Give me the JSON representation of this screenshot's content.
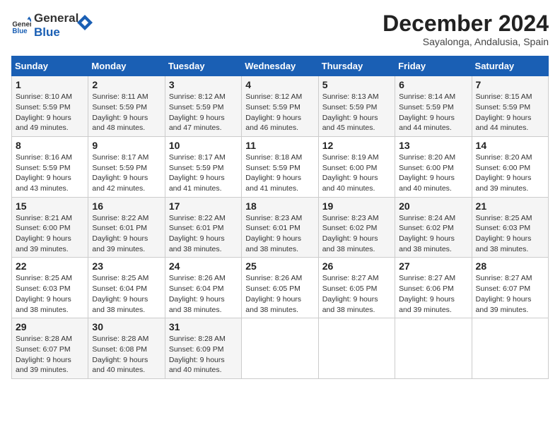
{
  "logo": {
    "line1": "General",
    "line2": "Blue"
  },
  "title": "December 2024",
  "subtitle": "Sayalonga, Andalusia, Spain",
  "weekdays": [
    "Sunday",
    "Monday",
    "Tuesday",
    "Wednesday",
    "Thursday",
    "Friday",
    "Saturday"
  ],
  "weeks": [
    [
      {
        "day": "1",
        "sunrise": "8:10 AM",
        "sunset": "5:59 PM",
        "daylight": "9 hours and 49 minutes."
      },
      {
        "day": "2",
        "sunrise": "8:11 AM",
        "sunset": "5:59 PM",
        "daylight": "9 hours and 48 minutes."
      },
      {
        "day": "3",
        "sunrise": "8:12 AM",
        "sunset": "5:59 PM",
        "daylight": "9 hours and 47 minutes."
      },
      {
        "day": "4",
        "sunrise": "8:12 AM",
        "sunset": "5:59 PM",
        "daylight": "9 hours and 46 minutes."
      },
      {
        "day": "5",
        "sunrise": "8:13 AM",
        "sunset": "5:59 PM",
        "daylight": "9 hours and 45 minutes."
      },
      {
        "day": "6",
        "sunrise": "8:14 AM",
        "sunset": "5:59 PM",
        "daylight": "9 hours and 44 minutes."
      },
      {
        "day": "7",
        "sunrise": "8:15 AM",
        "sunset": "5:59 PM",
        "daylight": "9 hours and 44 minutes."
      }
    ],
    [
      {
        "day": "8",
        "sunrise": "8:16 AM",
        "sunset": "5:59 PM",
        "daylight": "9 hours and 43 minutes."
      },
      {
        "day": "9",
        "sunrise": "8:17 AM",
        "sunset": "5:59 PM",
        "daylight": "9 hours and 42 minutes."
      },
      {
        "day": "10",
        "sunrise": "8:17 AM",
        "sunset": "5:59 PM",
        "daylight": "9 hours and 41 minutes."
      },
      {
        "day": "11",
        "sunrise": "8:18 AM",
        "sunset": "5:59 PM",
        "daylight": "9 hours and 41 minutes."
      },
      {
        "day": "12",
        "sunrise": "8:19 AM",
        "sunset": "6:00 PM",
        "daylight": "9 hours and 40 minutes."
      },
      {
        "day": "13",
        "sunrise": "8:20 AM",
        "sunset": "6:00 PM",
        "daylight": "9 hours and 40 minutes."
      },
      {
        "day": "14",
        "sunrise": "8:20 AM",
        "sunset": "6:00 PM",
        "daylight": "9 hours and 39 minutes."
      }
    ],
    [
      {
        "day": "15",
        "sunrise": "8:21 AM",
        "sunset": "6:00 PM",
        "daylight": "9 hours and 39 minutes."
      },
      {
        "day": "16",
        "sunrise": "8:22 AM",
        "sunset": "6:01 PM",
        "daylight": "9 hours and 39 minutes."
      },
      {
        "day": "17",
        "sunrise": "8:22 AM",
        "sunset": "6:01 PM",
        "daylight": "9 hours and 38 minutes."
      },
      {
        "day": "18",
        "sunrise": "8:23 AM",
        "sunset": "6:01 PM",
        "daylight": "9 hours and 38 minutes."
      },
      {
        "day": "19",
        "sunrise": "8:23 AM",
        "sunset": "6:02 PM",
        "daylight": "9 hours and 38 minutes."
      },
      {
        "day": "20",
        "sunrise": "8:24 AM",
        "sunset": "6:02 PM",
        "daylight": "9 hours and 38 minutes."
      },
      {
        "day": "21",
        "sunrise": "8:25 AM",
        "sunset": "6:03 PM",
        "daylight": "9 hours and 38 minutes."
      }
    ],
    [
      {
        "day": "22",
        "sunrise": "8:25 AM",
        "sunset": "6:03 PM",
        "daylight": "9 hours and 38 minutes."
      },
      {
        "day": "23",
        "sunrise": "8:25 AM",
        "sunset": "6:04 PM",
        "daylight": "9 hours and 38 minutes."
      },
      {
        "day": "24",
        "sunrise": "8:26 AM",
        "sunset": "6:04 PM",
        "daylight": "9 hours and 38 minutes."
      },
      {
        "day": "25",
        "sunrise": "8:26 AM",
        "sunset": "6:05 PM",
        "daylight": "9 hours and 38 minutes."
      },
      {
        "day": "26",
        "sunrise": "8:27 AM",
        "sunset": "6:05 PM",
        "daylight": "9 hours and 38 minutes."
      },
      {
        "day": "27",
        "sunrise": "8:27 AM",
        "sunset": "6:06 PM",
        "daylight": "9 hours and 39 minutes."
      },
      {
        "day": "28",
        "sunrise": "8:27 AM",
        "sunset": "6:07 PM",
        "daylight": "9 hours and 39 minutes."
      }
    ],
    [
      {
        "day": "29",
        "sunrise": "8:28 AM",
        "sunset": "6:07 PM",
        "daylight": "9 hours and 39 minutes."
      },
      {
        "day": "30",
        "sunrise": "8:28 AM",
        "sunset": "6:08 PM",
        "daylight": "9 hours and 40 minutes."
      },
      {
        "day": "31",
        "sunrise": "8:28 AM",
        "sunset": "6:09 PM",
        "daylight": "9 hours and 40 minutes."
      },
      null,
      null,
      null,
      null
    ]
  ]
}
